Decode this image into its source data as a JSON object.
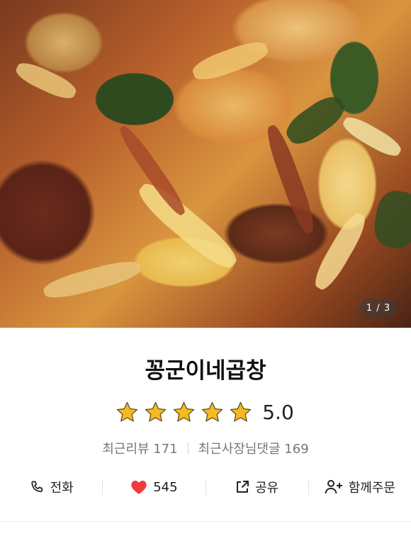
{
  "gallery": {
    "current": 1,
    "total": 3,
    "indicator": "1 / 3"
  },
  "store": {
    "name": "꽁군이네곱창",
    "rating": 5.0,
    "rating_text": "5.0",
    "stars_filled": 5,
    "star_color": "#F5B921"
  },
  "counts": {
    "recent_reviews": "최근리뷰 171",
    "owner_replies": "최근사장님댓글 169"
  },
  "actions": {
    "call_label": "전화",
    "like_count": "545",
    "like_color": "#F23A3A",
    "share_label": "공유",
    "group_order_label": "함께주문"
  }
}
